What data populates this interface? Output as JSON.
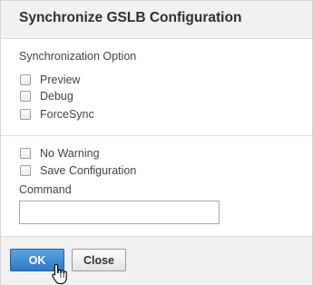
{
  "dialog": {
    "title": "Synchronize GSLB Configuration"
  },
  "sync_options": {
    "label": "Synchronization Option",
    "items": [
      {
        "label": "Preview",
        "checked": false
      },
      {
        "label": "Debug",
        "checked": false
      },
      {
        "label": "ForceSync",
        "checked": false
      }
    ]
  },
  "other_options": {
    "items": [
      {
        "label": "No Warning",
        "checked": false
      },
      {
        "label": "Save Configuration",
        "checked": false
      }
    ]
  },
  "command": {
    "label": "Command",
    "value": ""
  },
  "footer": {
    "ok_label": "OK",
    "close_label": "Close"
  },
  "colors": {
    "primary_button": "#2c79c4",
    "header_bg": "#f1f1f1"
  },
  "icons": {
    "cursor": "hand-pointer-icon"
  }
}
